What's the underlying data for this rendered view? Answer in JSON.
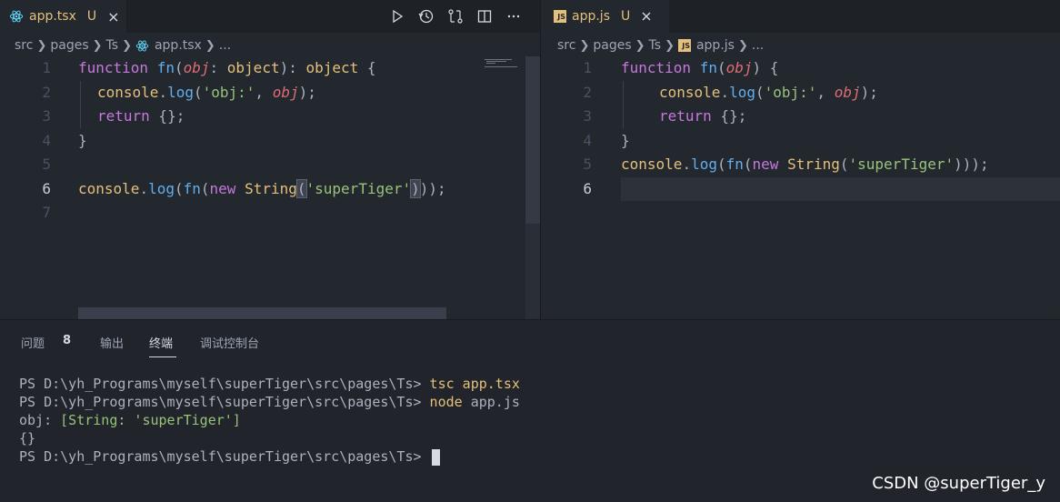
{
  "left_editor": {
    "tab": {
      "filename": "app.tsx",
      "status": "U",
      "close_icon": "×",
      "icon": "react-icon"
    },
    "actions": [
      "run-icon",
      "history-icon",
      "compare-changes-icon",
      "split-editor-icon",
      "more-icon"
    ],
    "breadcrumb": {
      "parts": [
        "src",
        "pages",
        "Ts"
      ],
      "file": "app.tsx",
      "ellipsis": "..."
    },
    "line_numbers": [
      "1",
      "2",
      "3",
      "4",
      "5",
      "6",
      "7"
    ],
    "active_line": "6"
  },
  "right_editor": {
    "tab": {
      "filename": "app.js",
      "status": "U",
      "icon_text": "JS"
    },
    "breadcrumb": {
      "parts": [
        "src",
        "pages",
        "Ts"
      ],
      "file": "app.js",
      "ellipsis": "...",
      "file_icon_text": "JS"
    },
    "line_numbers": [
      "1",
      "2",
      "3",
      "4",
      "5",
      "6"
    ],
    "active_line": "6"
  },
  "panel": {
    "tabs": {
      "problems": "问题",
      "problems_count": "8",
      "output": "输出",
      "terminal": "终端",
      "debug_console": "调试控制台"
    },
    "terminal": {
      "prompt": "PS D:\\yh_Programs\\myself\\superTiger\\src\\pages\\Ts>",
      "cmd1": "tsc app.tsx",
      "cmd2": "node",
      "cmd2_arg": "app.js",
      "out_label": "obj:",
      "out_value": "[String: 'superTiger']",
      "out2": "{}"
    }
  },
  "watermark": "CSDN @superTiger_y",
  "colors": {
    "keyword": "#c678dd",
    "function": "#61afef",
    "param": "#e06c75",
    "string": "#98c379",
    "type": "#e5c07b"
  }
}
